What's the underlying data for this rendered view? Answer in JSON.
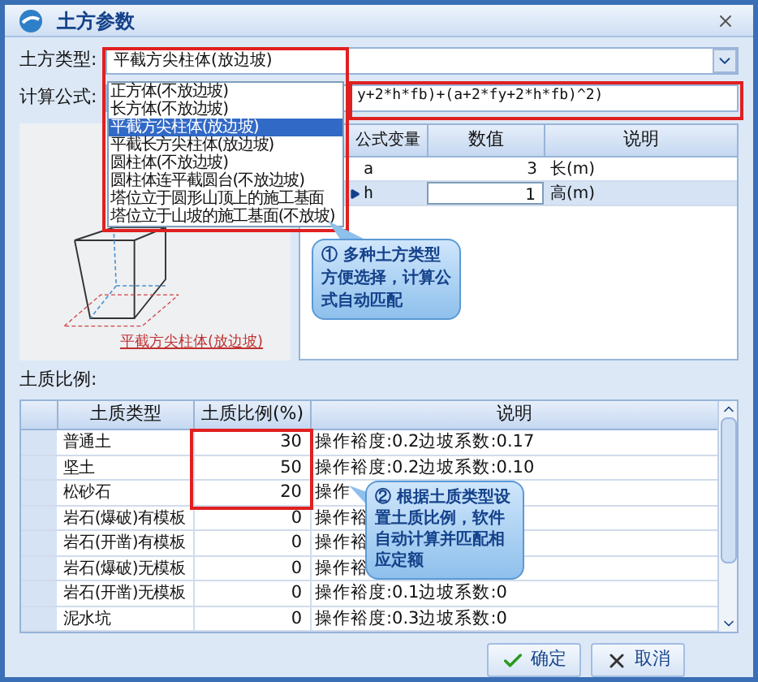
{
  "window": {
    "title": "土方参数"
  },
  "earthwork_type": {
    "label": "土方类型:",
    "value": "平截方尖柱体(放边坡)",
    "options": [
      {
        "label": "正方体(不放边坡)",
        "selected": false
      },
      {
        "label": "长方体(不放边坡)",
        "selected": false
      },
      {
        "label": "平截方尖柱体(放边坡)",
        "selected": true
      },
      {
        "label": "平截长方尖柱体(放边坡)",
        "selected": false
      },
      {
        "label": "圆柱体(不放边坡)",
        "selected": false
      },
      {
        "label": "圆柱体连平截圆台(不放边坡)",
        "selected": false
      },
      {
        "label": "塔位立于圆形山顶上的施工基面",
        "selected": false
      },
      {
        "label": "塔位立于山坡的施工基面(不放坡)",
        "selected": false
      }
    ]
  },
  "formula": {
    "label": "计算公式:",
    "value": "y+2*h*fb)+(a+2*fy+2*h*fb)^2)"
  },
  "diagram": {
    "caption": "平截方尖柱体(放边坡)"
  },
  "variables": {
    "columns": [
      "公式变量",
      "数值",
      "说明"
    ],
    "rows": [
      {
        "name": "a",
        "value": "3",
        "description": "长(m)",
        "selected": false
      },
      {
        "name": "h",
        "value": "1",
        "description": "高(m)",
        "selected": true
      }
    ]
  },
  "callouts": [
    "① 多种土方类型方便选择，计算公式自动匹配",
    "② 根据土质类型设置土质比例，软件自动计算并匹配相应定额"
  ],
  "soil_ratio": {
    "label": "土质比例:",
    "columns": [
      "土质类型",
      "土质比例(%)",
      "说明"
    ],
    "rows": [
      {
        "type": "普通土",
        "ratio": "30",
        "description": "操作裕度:0.2边坡系数:0.17"
      },
      {
        "type": "坚土",
        "ratio": "50",
        "description": "操作裕度:0.2边坡系数:0.10"
      },
      {
        "type": "松砂石",
        "ratio": "20",
        "description": "操作"
      },
      {
        "type": "岩石(爆破)有模板",
        "ratio": "0",
        "description": "操作裕"
      },
      {
        "type": "岩石(开凿)有模板",
        "ratio": "0",
        "description": "操作裕"
      },
      {
        "type": "岩石(爆破)无模板",
        "ratio": "0",
        "description": "操作裕"
      },
      {
        "type": "岩石(开凿)无模板",
        "ratio": "0",
        "description": "操作裕度:0.1边坡系数:0"
      },
      {
        "type": "泥水坑",
        "ratio": "0",
        "description": "操作裕度:0.3边坡系数:0"
      }
    ]
  },
  "buttons": [
    {
      "kind": "ok",
      "label": "确定"
    },
    {
      "kind": "cancel",
      "label": "取消"
    }
  ]
}
